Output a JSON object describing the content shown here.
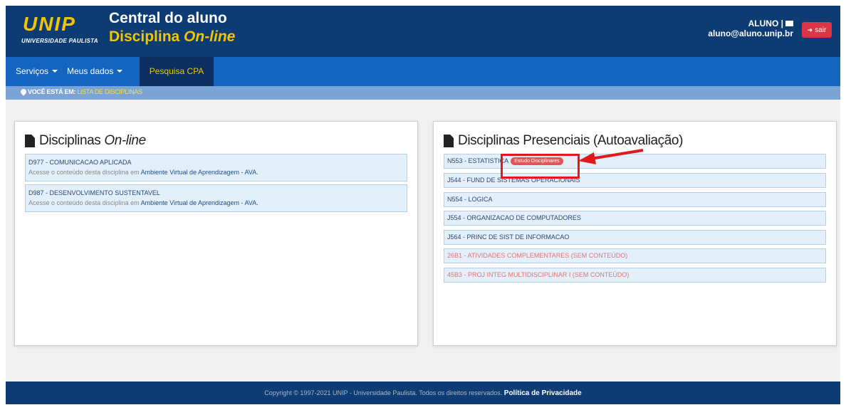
{
  "header": {
    "logo_text": "UNIP",
    "logo_subtitle": "UNIVERSIDADE PAULISTA",
    "title_line1": "Central do aluno",
    "title_line2_prefix": "Disciplina ",
    "title_line2_italic": "On-line",
    "user_name": "ALUNO |",
    "user_email": "aluno@aluno.unip.br",
    "logout_label": "sair",
    "logout_icon": "sign-out-icon",
    "mail_icon": "envelope-icon"
  },
  "nav": {
    "items": [
      {
        "label": "Serviços"
      },
      {
        "label": "Meus dados"
      },
      {
        "label": "Pesquisa CPA"
      }
    ]
  },
  "breadcrumb": {
    "prefix": "VOCÊ ESTÁ EM:",
    "current": "LISTA DE DISCIPLINAS"
  },
  "online_panel": {
    "title_prefix": "Disciplinas ",
    "title_italic": "On-line",
    "courses": [
      {
        "name": "D977 - COMUNICACAO APLICADA",
        "hint_prefix": "Acesse o conteúdo desta disciplina em ",
        "hint_link": "Ambiente Virtual de Aprendizagem - AVA."
      },
      {
        "name": "D987 - DESENVOLVIMENTO SUSTENTAVEL",
        "hint_prefix": "Acesse o conteúdo desta disciplina em ",
        "hint_link": "Ambiente Virtual de Aprendizagem - AVA."
      }
    ]
  },
  "presencial_panel": {
    "title": "Disciplinas Presenciais (Autoavaliação)",
    "courses": [
      {
        "name": "N553 - ESTATISTICA",
        "badge": "Estudo Disciplinares"
      },
      {
        "name": "J544 - FUND DE SISTEMAS OPERACIONAIS"
      },
      {
        "name": "N554 - LOGICA"
      },
      {
        "name": "J554 - ORGANIZACAO DE COMPUTADORES"
      },
      {
        "name": "J564 - PRINC DE SIST DE INFORMACAO"
      },
      {
        "name": "26B1 - ATIVIDADES COMPLEMENTARES (SEM CONTEÚDO)",
        "disabled": true
      },
      {
        "name": "45B3 - PROJ INTEG MULTIDISCIPLINAR I (SEM CONTEÚDO)",
        "disabled": true
      }
    ]
  },
  "footer": {
    "copyright": "Copyright © 1997-2021 UNIP - Universidade Paulista. Todos os direitos reservados.",
    "privacy_link": "Política de Privacidade"
  },
  "colors": {
    "header_bg": "#0d3b73",
    "nav_bg": "#1565c0",
    "accent_yellow": "#f4c400",
    "logout_red": "#dc3545",
    "annotation_red": "#e01a1a"
  }
}
